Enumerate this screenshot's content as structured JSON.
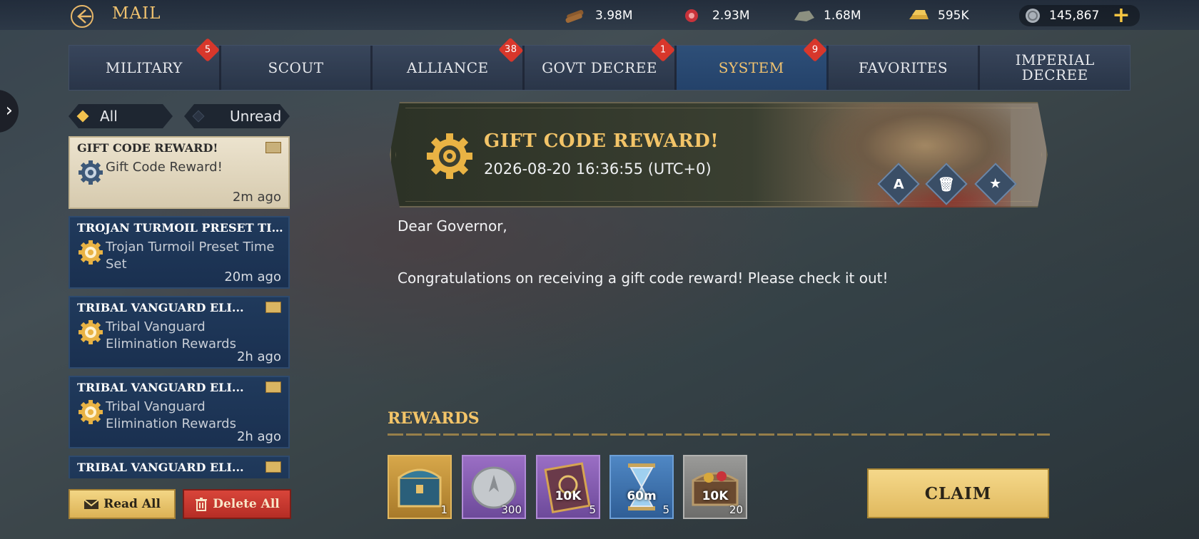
{
  "header": {
    "title": "MAIL",
    "back_icon": "back-arrow-icon"
  },
  "resources": [
    {
      "name": "wood",
      "icon": "wood-icon",
      "value": "3.98M"
    },
    {
      "name": "food",
      "icon": "meat-icon",
      "value": "2.93M"
    },
    {
      "name": "stone",
      "icon": "stone-icon",
      "value": "1.68M"
    },
    {
      "name": "gold",
      "icon": "gold-bar-icon",
      "value": "595K"
    },
    {
      "name": "silver",
      "icon": "silver-coin-icon",
      "value": "145,867"
    }
  ],
  "tabs": [
    {
      "label": "MILITARY",
      "badge": "5",
      "active": false
    },
    {
      "label": "SCOUT",
      "badge": "",
      "active": false
    },
    {
      "label": "ALLIANCE",
      "badge": "38",
      "active": false
    },
    {
      "label": "GOVT DECREE",
      "badge": "1",
      "active": false
    },
    {
      "label": "SYSTEM",
      "badge": "9",
      "active": true
    },
    {
      "label": "FAVORITES",
      "badge": "",
      "active": false
    },
    {
      "label": "IMPERIAL DECREE",
      "badge": "",
      "active": false
    }
  ],
  "filters": {
    "all": "All",
    "unread": "Unread"
  },
  "mail_list": [
    {
      "title": "GIFT CODE REWARD!",
      "subtitle": "Gift Code Reward!",
      "time": "2m ago",
      "selected": true
    },
    {
      "title": "TROJAN TURMOIL PRESET TIM...",
      "subtitle": "Trojan Turmoil Preset Time Set",
      "time": "20m ago",
      "selected": false
    },
    {
      "title": "TRIBAL VANGUARD ELI...",
      "subtitle": "Tribal Vanguard Elimination Rewards",
      "time": "2h ago",
      "selected": false
    },
    {
      "title": "TRIBAL VANGUARD ELI...",
      "subtitle": "Tribal Vanguard Elimination Rewards",
      "time": "2h ago",
      "selected": false
    },
    {
      "title": "TRIBAL VANGUARD ELI...",
      "subtitle": "",
      "time": "",
      "selected": false
    }
  ],
  "actions": {
    "read_all": "Read All",
    "delete_all": "Delete All"
  },
  "mail": {
    "title": "GIFT CODE REWARD!",
    "date": "2026-08-20 16:36:55 (UTC+0)",
    "greeting": "Dear Governor,",
    "body": "Congratulations on receiving a gift code reward! Please check it out!",
    "action_icons": [
      "translate-icon",
      "trash-icon",
      "star-icon"
    ]
  },
  "rewards": {
    "title": "REWARDS",
    "items": [
      {
        "icon": "treasure-chest-icon",
        "value": "",
        "qty": "1",
        "rarity": "gold"
      },
      {
        "icon": "silver-medal-icon",
        "value": "",
        "qty": "300",
        "rarity": "purple"
      },
      {
        "icon": "tome-icon",
        "value": "10K",
        "qty": "5",
        "rarity": "purple"
      },
      {
        "icon": "hourglass-icon",
        "value": "60m",
        "qty": "5",
        "rarity": "blue"
      },
      {
        "icon": "resource-chest-icon",
        "value": "10K",
        "qty": "20",
        "rarity": "grey"
      }
    ],
    "claim": "CLAIM"
  },
  "colors": {
    "accent": "#f0c26f",
    "active_tab": "#24426a",
    "badge": "#d8372b",
    "delete": "#b52d25"
  }
}
